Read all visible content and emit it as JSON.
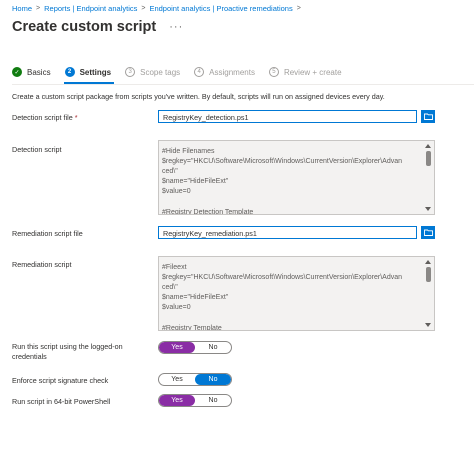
{
  "breadcrumb": [
    "Home",
    "Reports | Endpoint analytics",
    "Endpoint analytics | Proactive remediations"
  ],
  "page_title": "Create custom script",
  "more_label": "···",
  "steps": [
    {
      "num": "✓",
      "label": "Basics",
      "state": "done"
    },
    {
      "num": "2",
      "label": "Settings",
      "state": "current"
    },
    {
      "num": "3",
      "label": "Scope tags",
      "state": "pending"
    },
    {
      "num": "4",
      "label": "Assignments",
      "state": "pending"
    },
    {
      "num": "5",
      "label": "Review + create",
      "state": "pending"
    }
  ],
  "description": "Create a custom script package from scripts you've written. By default, scripts will run on assigned devices every day.",
  "detection_file": {
    "label": "Detection script file",
    "required_mark": "*",
    "value": "RegistryKey_detection.ps1"
  },
  "detection_script": {
    "label": "Detection script",
    "content": "#Hide Filenames\n$regkey=\"HKCU\\Software\\Microsoft\\Windows\\CurrentVersion\\Explorer\\Advan\nced\\\"\n$name=\"HideFileExt\"\n$value=0\n\n#Registry Detection Template"
  },
  "remediation_file": {
    "label": "Remediation script file",
    "value": "RegistryKey_remediation.ps1"
  },
  "remediation_script": {
    "label": "Remediation script",
    "content": "#Fileext\n$regkey=\"HKCU\\Software\\Microsoft\\Windows\\CurrentVersion\\Explorer\\Advan\nced\\\"\n$name=\"HideFileExt\"\n$value=0\n\n#Registry Template"
  },
  "options": [
    {
      "label": "Run this script using the logged-on credentials",
      "yes": "Yes",
      "no": "No",
      "selected": "Yes"
    },
    {
      "label": "Enforce script signature check",
      "yes": "Yes",
      "no": "No",
      "selected": "No"
    },
    {
      "label": "Run script in 64-bit PowerShell",
      "yes": "Yes",
      "no": "No",
      "selected": "Yes"
    }
  ],
  "colors": {
    "accent": "#0078d4",
    "toggle_yes": "#8a2da5",
    "done": "#107c10"
  },
  "icons": {
    "browse": "folder-icon",
    "more": "ellipsis-icon",
    "done_step": "checkmark-icon"
  }
}
